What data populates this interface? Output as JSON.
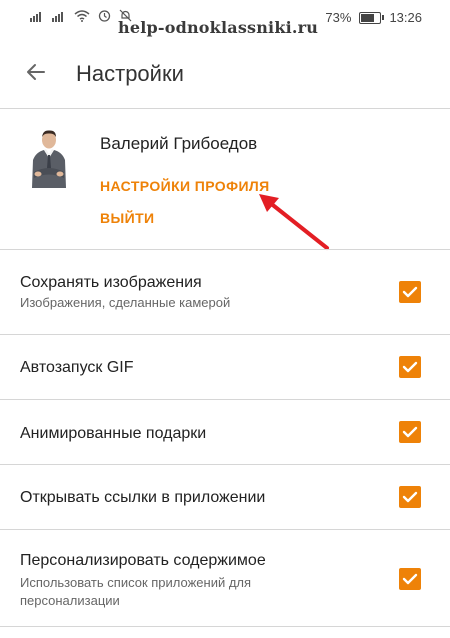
{
  "status_bar": {
    "left_icons": [
      "sim-signal-icon",
      "mobile-data-icon",
      "wifi-icon",
      "alarm-icon",
      "notification-muted-icon"
    ],
    "watermark": "help-odnoklassniki.ru",
    "battery_percent": "73%",
    "time": "13:26"
  },
  "app_bar": {
    "back_icon": "arrow-back-icon",
    "title": "Настройки"
  },
  "profile": {
    "name": "Валерий Грибоедов",
    "settings_link": "НАСТРОЙКИ ПРОФИЛЯ",
    "logout_link": "ВЫЙТИ"
  },
  "settings": [
    {
      "title": "Сохранять изображения",
      "subtitle": "Изображения, сделанные камерой",
      "checked": true
    },
    {
      "title": "Автозапуск GIF",
      "subtitle": "",
      "checked": true
    },
    {
      "title": "Анимированные подарки",
      "subtitle": "",
      "checked": true
    },
    {
      "title": "Открывать ссылки в приложении",
      "subtitle": "",
      "checked": true
    },
    {
      "title": "Персонализировать содержимое",
      "subtitle": "Использовать список приложений для персонализации",
      "checked": true
    }
  ],
  "colors": {
    "accent": "#ee8208",
    "annotation_arrow": "#e31e24",
    "divider": "#d6d6d6"
  }
}
